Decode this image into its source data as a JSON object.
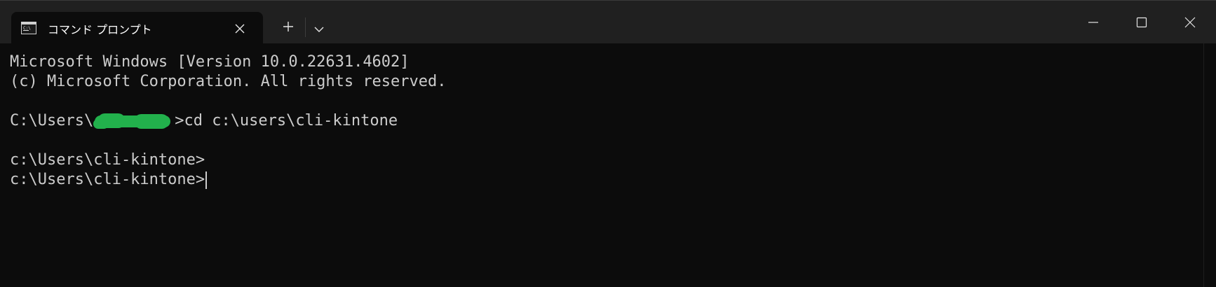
{
  "window": {
    "tab_title": "コマンド プロンプト",
    "icons": {
      "tab": "command-prompt-icon",
      "close_tab": "close-icon",
      "new_tab": "plus-icon",
      "dropdown": "chevron-down-icon",
      "minimize": "minimize-icon",
      "maximize": "maximize-icon",
      "close_window": "close-icon"
    }
  },
  "terminal": {
    "lines": [
      "Microsoft Windows [Version 10.0.22631.4602]",
      "(c) Microsoft Corporation. All rights reserved.",
      "",
      "",
      "",
      "c:\\Users\\cli-kintone>",
      "c:\\Users\\cli-kintone>"
    ],
    "prompt_prefix": "C:\\Users\\",
    "command": ">cd c:\\users\\cli-kintone",
    "text_color": "#cccccc",
    "background_color": "#0c0c0c",
    "redaction_color": "#22b14c"
  }
}
